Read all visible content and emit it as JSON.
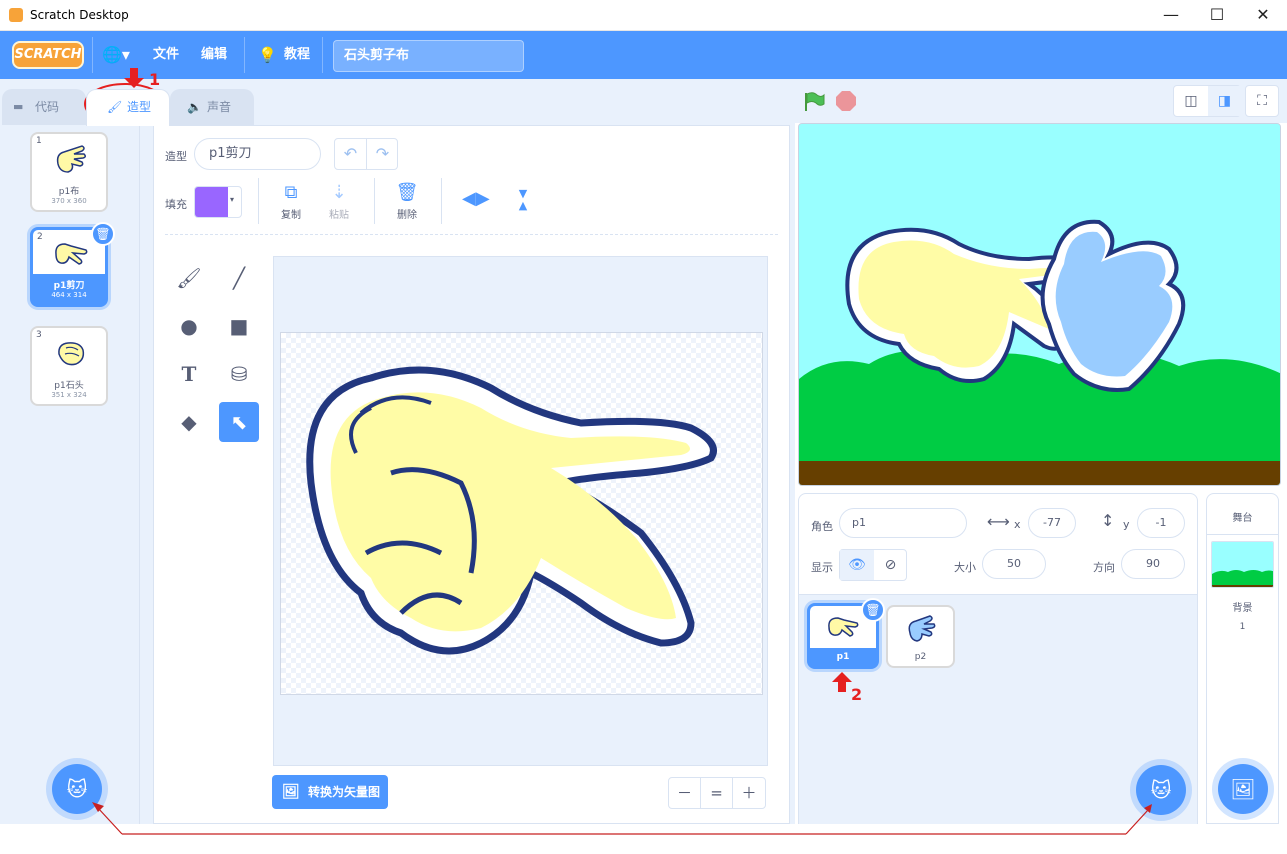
{
  "window": {
    "title": "Scratch Desktop",
    "minimize": "—",
    "maximize": "☐",
    "close": "✕"
  },
  "menubar": {
    "logo": "SCRATCH",
    "globe": "🌐▾",
    "file": "文件",
    "edit": "编辑",
    "tutorial": "教程",
    "project_title": "石头剪子布"
  },
  "tabs": {
    "code": "代码",
    "costumes": "造型",
    "sounds": "声音"
  },
  "costumes": [
    {
      "num": "1",
      "name": "p1布",
      "size": "370 x 360"
    },
    {
      "num": "2",
      "name": "p1剪刀",
      "size": "464 x 314"
    },
    {
      "num": "3",
      "name": "p1石头",
      "size": "351 x 324"
    }
  ],
  "paint": {
    "costume_label": "造型",
    "costume_name": "p1剪刀",
    "fill_label": "填充",
    "fill_color": "#9966ff",
    "copy": "复制",
    "paste": "粘贴",
    "delete": "删除",
    "convert": "转换为矢量图",
    "zoom_out": "－",
    "zoom_reset": "=",
    "zoom_in": "＋"
  },
  "sprite_info": {
    "sprite_label": "角色",
    "sprite_name": "p1",
    "x_label": "x",
    "x_value": "-77",
    "y_label": "y",
    "y_value": "-1",
    "show_label": "显示",
    "size_label": "大小",
    "size_value": "50",
    "direction_label": "方向",
    "direction_value": "90"
  },
  "sprites": [
    {
      "name": "p1"
    },
    {
      "name": "p2"
    }
  ],
  "stage_pane": {
    "label": "舞台",
    "backdrops_label": "背景",
    "backdrops_count": "1"
  },
  "annotations": {
    "one": "1",
    "two": "2"
  },
  "colors": {
    "accent": "#4d97ff",
    "annotation": "#e52020"
  }
}
